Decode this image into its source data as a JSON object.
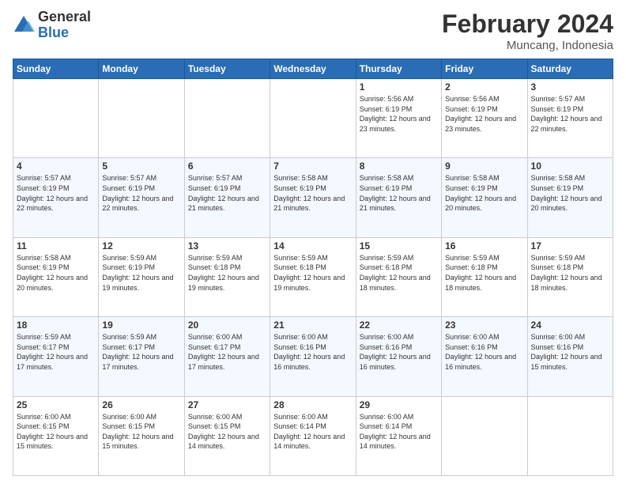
{
  "logo": {
    "general": "General",
    "blue": "Blue"
  },
  "title": "February 2024",
  "location": "Muncang, Indonesia",
  "days_of_week": [
    "Sunday",
    "Monday",
    "Tuesday",
    "Wednesday",
    "Thursday",
    "Friday",
    "Saturday"
  ],
  "weeks": [
    [
      {
        "day": "",
        "info": ""
      },
      {
        "day": "",
        "info": ""
      },
      {
        "day": "",
        "info": ""
      },
      {
        "day": "",
        "info": ""
      },
      {
        "day": "1",
        "info": "Sunrise: 5:56 AM\nSunset: 6:19 PM\nDaylight: 12 hours and 23 minutes."
      },
      {
        "day": "2",
        "info": "Sunrise: 5:56 AM\nSunset: 6:19 PM\nDaylight: 12 hours and 23 minutes."
      },
      {
        "day": "3",
        "info": "Sunrise: 5:57 AM\nSunset: 6:19 PM\nDaylight: 12 hours and 22 minutes."
      }
    ],
    [
      {
        "day": "4",
        "info": "Sunrise: 5:57 AM\nSunset: 6:19 PM\nDaylight: 12 hours and 22 minutes."
      },
      {
        "day": "5",
        "info": "Sunrise: 5:57 AM\nSunset: 6:19 PM\nDaylight: 12 hours and 22 minutes."
      },
      {
        "day": "6",
        "info": "Sunrise: 5:57 AM\nSunset: 6:19 PM\nDaylight: 12 hours and 21 minutes."
      },
      {
        "day": "7",
        "info": "Sunrise: 5:58 AM\nSunset: 6:19 PM\nDaylight: 12 hours and 21 minutes."
      },
      {
        "day": "8",
        "info": "Sunrise: 5:58 AM\nSunset: 6:19 PM\nDaylight: 12 hours and 21 minutes."
      },
      {
        "day": "9",
        "info": "Sunrise: 5:58 AM\nSunset: 6:19 PM\nDaylight: 12 hours and 20 minutes."
      },
      {
        "day": "10",
        "info": "Sunrise: 5:58 AM\nSunset: 6:19 PM\nDaylight: 12 hours and 20 minutes."
      }
    ],
    [
      {
        "day": "11",
        "info": "Sunrise: 5:58 AM\nSunset: 6:19 PM\nDaylight: 12 hours and 20 minutes."
      },
      {
        "day": "12",
        "info": "Sunrise: 5:59 AM\nSunset: 6:19 PM\nDaylight: 12 hours and 19 minutes."
      },
      {
        "day": "13",
        "info": "Sunrise: 5:59 AM\nSunset: 6:18 PM\nDaylight: 12 hours and 19 minutes."
      },
      {
        "day": "14",
        "info": "Sunrise: 5:59 AM\nSunset: 6:18 PM\nDaylight: 12 hours and 19 minutes."
      },
      {
        "day": "15",
        "info": "Sunrise: 5:59 AM\nSunset: 6:18 PM\nDaylight: 12 hours and 18 minutes."
      },
      {
        "day": "16",
        "info": "Sunrise: 5:59 AM\nSunset: 6:18 PM\nDaylight: 12 hours and 18 minutes."
      },
      {
        "day": "17",
        "info": "Sunrise: 5:59 AM\nSunset: 6:18 PM\nDaylight: 12 hours and 18 minutes."
      }
    ],
    [
      {
        "day": "18",
        "info": "Sunrise: 5:59 AM\nSunset: 6:17 PM\nDaylight: 12 hours and 17 minutes."
      },
      {
        "day": "19",
        "info": "Sunrise: 5:59 AM\nSunset: 6:17 PM\nDaylight: 12 hours and 17 minutes."
      },
      {
        "day": "20",
        "info": "Sunrise: 6:00 AM\nSunset: 6:17 PM\nDaylight: 12 hours and 17 minutes."
      },
      {
        "day": "21",
        "info": "Sunrise: 6:00 AM\nSunset: 6:16 PM\nDaylight: 12 hours and 16 minutes."
      },
      {
        "day": "22",
        "info": "Sunrise: 6:00 AM\nSunset: 6:16 PM\nDaylight: 12 hours and 16 minutes."
      },
      {
        "day": "23",
        "info": "Sunrise: 6:00 AM\nSunset: 6:16 PM\nDaylight: 12 hours and 16 minutes."
      },
      {
        "day": "24",
        "info": "Sunrise: 6:00 AM\nSunset: 6:16 PM\nDaylight: 12 hours and 15 minutes."
      }
    ],
    [
      {
        "day": "25",
        "info": "Sunrise: 6:00 AM\nSunset: 6:15 PM\nDaylight: 12 hours and 15 minutes."
      },
      {
        "day": "26",
        "info": "Sunrise: 6:00 AM\nSunset: 6:15 PM\nDaylight: 12 hours and 15 minutes."
      },
      {
        "day": "27",
        "info": "Sunrise: 6:00 AM\nSunset: 6:15 PM\nDaylight: 12 hours and 14 minutes."
      },
      {
        "day": "28",
        "info": "Sunrise: 6:00 AM\nSunset: 6:14 PM\nDaylight: 12 hours and 14 minutes."
      },
      {
        "day": "29",
        "info": "Sunrise: 6:00 AM\nSunset: 6:14 PM\nDaylight: 12 hours and 14 minutes."
      },
      {
        "day": "",
        "info": ""
      },
      {
        "day": "",
        "info": ""
      }
    ]
  ]
}
